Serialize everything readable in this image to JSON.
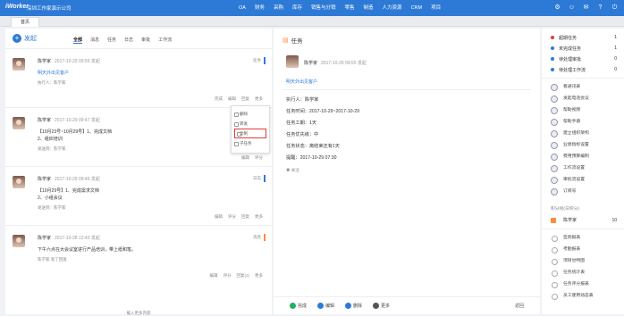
{
  "app": {
    "logo": "iWorker",
    "company": "深圳工作家演示公司"
  },
  "nav": [
    "OA",
    "财务",
    "采购",
    "库存",
    "销售与分销",
    "零售",
    "制造",
    "人力资源",
    "CRM",
    "项目"
  ],
  "tabs": {
    "home": "首页"
  },
  "left": {
    "compose": "发起",
    "filters": [
      "全部",
      "消息",
      "任务",
      "日志",
      "审批",
      "工作流"
    ],
    "posts": [
      {
        "author": "陈学家",
        "time": "2017-10-29 09:55 发起",
        "tag": "任务",
        "content": [
          "明天外出见客户"
        ],
        "sub": "执行人：陈学家",
        "link": true,
        "actions": [
          "完成",
          "编辑",
          "回复",
          "更多"
        ]
      },
      {
        "author": "陈学家",
        "time": "2017-10-29 09:47 发起",
        "tag": "日志",
        "content": [
          "【10月23号~10月29号】1、完成文档",
          "2、组织培训"
        ],
        "sub": "发送到：陈学家",
        "actions": [
          "编辑",
          "评分"
        ]
      },
      {
        "author": "陈学家",
        "time": "2017-10-29 09:46 发起",
        "tag": "日志",
        "content": [
          "【10月29号】1、完成需求文档",
          "2、小组会议"
        ],
        "sub": "发送到：陈学家",
        "actions": [
          "编辑",
          "评分",
          "回复",
          "更多"
        ]
      },
      {
        "author": "陈学家",
        "time": "2017-10-28 12:43 发起",
        "tag": "消息",
        "content": [
          "下午六点在大会议室进行产品培训，带上纸和笔。"
        ],
        "sub": "陈学家 发了回复",
        "actions": [
          "编辑",
          "评分",
          "回复(1)",
          "更多"
        ]
      }
    ],
    "more_menu": [
      "删除",
      "转发",
      "复制",
      "子任务"
    ],
    "load_more": "载入更多内容"
  },
  "mid": {
    "title": "任务",
    "author": "陈学家",
    "time": "2017-10-29 09:55 发起",
    "task": "明天外出见客户",
    "details": [
      "执行人：陈学家",
      "任务时间：2017-10-29~2017-10-29",
      "任务工期：1天",
      "任务优先级：中",
      "任务状态：离结束还有1天",
      "提醒：2017-10-29 07:30"
    ],
    "watch": "关注",
    "buttons": [
      "完成",
      "编辑",
      "删除",
      "更多"
    ],
    "back": "返回"
  },
  "right": {
    "stats": [
      {
        "label": "超期任务",
        "count": "1",
        "color": "red"
      },
      {
        "label": "未完成任务",
        "count": "1",
        "color": "blue"
      },
      {
        "label": "待处理审批",
        "count": "0",
        "color": "blue"
      },
      {
        "label": "待处理工作流",
        "count": "0",
        "color": "blue"
      }
    ],
    "menu": [
      "看通讯录",
      "发起电话会议",
      "帮助视频",
      "帮助手册",
      "建立组织架构",
      "业绩指标设置",
      "费用预算编制",
      "工作流设置",
      "审批流设置",
      "订阅号"
    ],
    "points_head": "积分榜(日积分)",
    "points_row": {
      "name": "陈学家",
      "score": "10"
    },
    "reports": [
      "签到报表",
      "考勤报表",
      "项目甘特图",
      "任务统计表",
      "任务评分报表",
      "员工使用动态表"
    ]
  }
}
